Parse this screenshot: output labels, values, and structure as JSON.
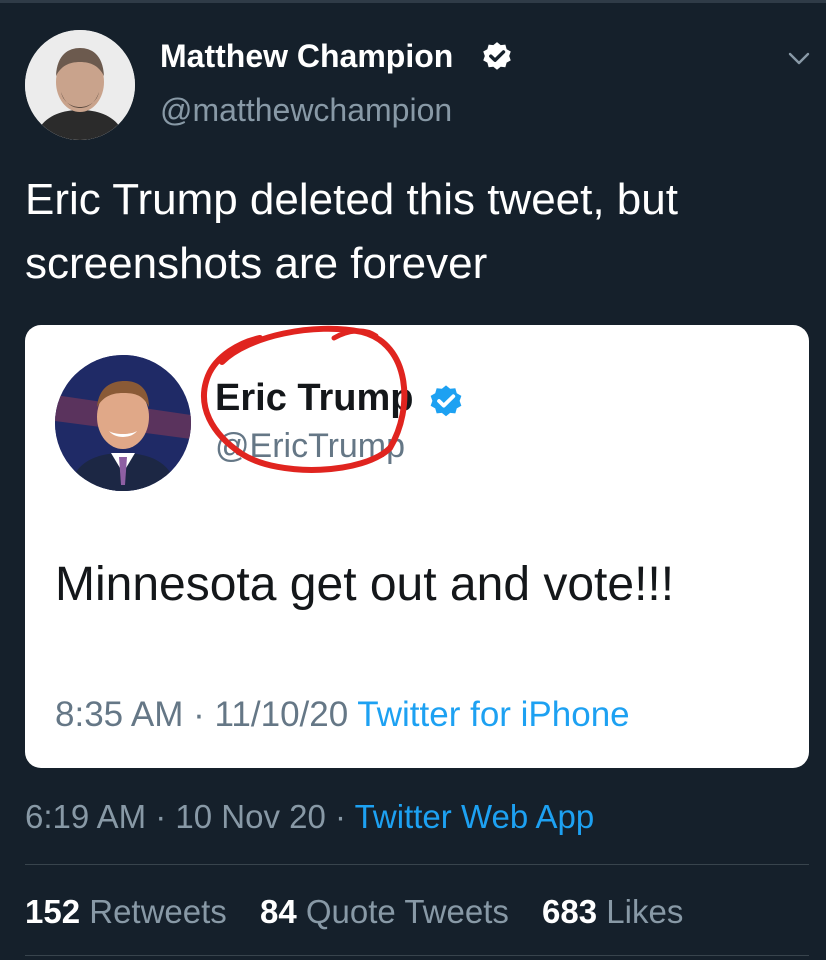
{
  "tweet": {
    "author": {
      "name": "Matthew Champion",
      "handle": "@matthewchampion"
    },
    "text_line1": "Eric Trump deleted this tweet, but",
    "text_line2": "screenshots are forever",
    "time": "6:19 AM",
    "date": "10 Nov 20",
    "source": "Twitter Web App",
    "stats": {
      "retweets_count": "152",
      "retweets_label": "Retweets",
      "quotes_count": "84",
      "quotes_label": "Quote Tweets",
      "likes_count": "683",
      "likes_label": "Likes"
    }
  },
  "embedded": {
    "name": "Eric Trump",
    "handle": "@EricTrump",
    "text": "Minnesota get out and vote!!!",
    "time": "8:35 AM",
    "date": "11/10/20",
    "source": "Twitter for iPhone"
  },
  "icons": {
    "verified": "verified-badge-icon",
    "menu": "chevron-down-icon"
  },
  "colors": {
    "background": "#15202b",
    "accent": "#1da1f2",
    "annotation": "#e0241f"
  }
}
